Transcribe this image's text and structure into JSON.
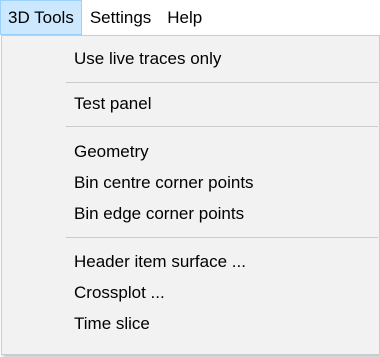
{
  "menubar": {
    "items": [
      {
        "label": "3D Tools"
      },
      {
        "label": "Settings"
      },
      {
        "label": "Help"
      }
    ]
  },
  "dropdown": {
    "items": [
      {
        "label": "Use live traces only"
      },
      {
        "label": "Test panel"
      },
      {
        "label": "Geometry"
      },
      {
        "label": "Bin centre corner points"
      },
      {
        "label": "Bin edge corner points"
      },
      {
        "label": "Header item surface ..."
      },
      {
        "label": "Crossplot ..."
      },
      {
        "label": "Time slice"
      }
    ]
  }
}
